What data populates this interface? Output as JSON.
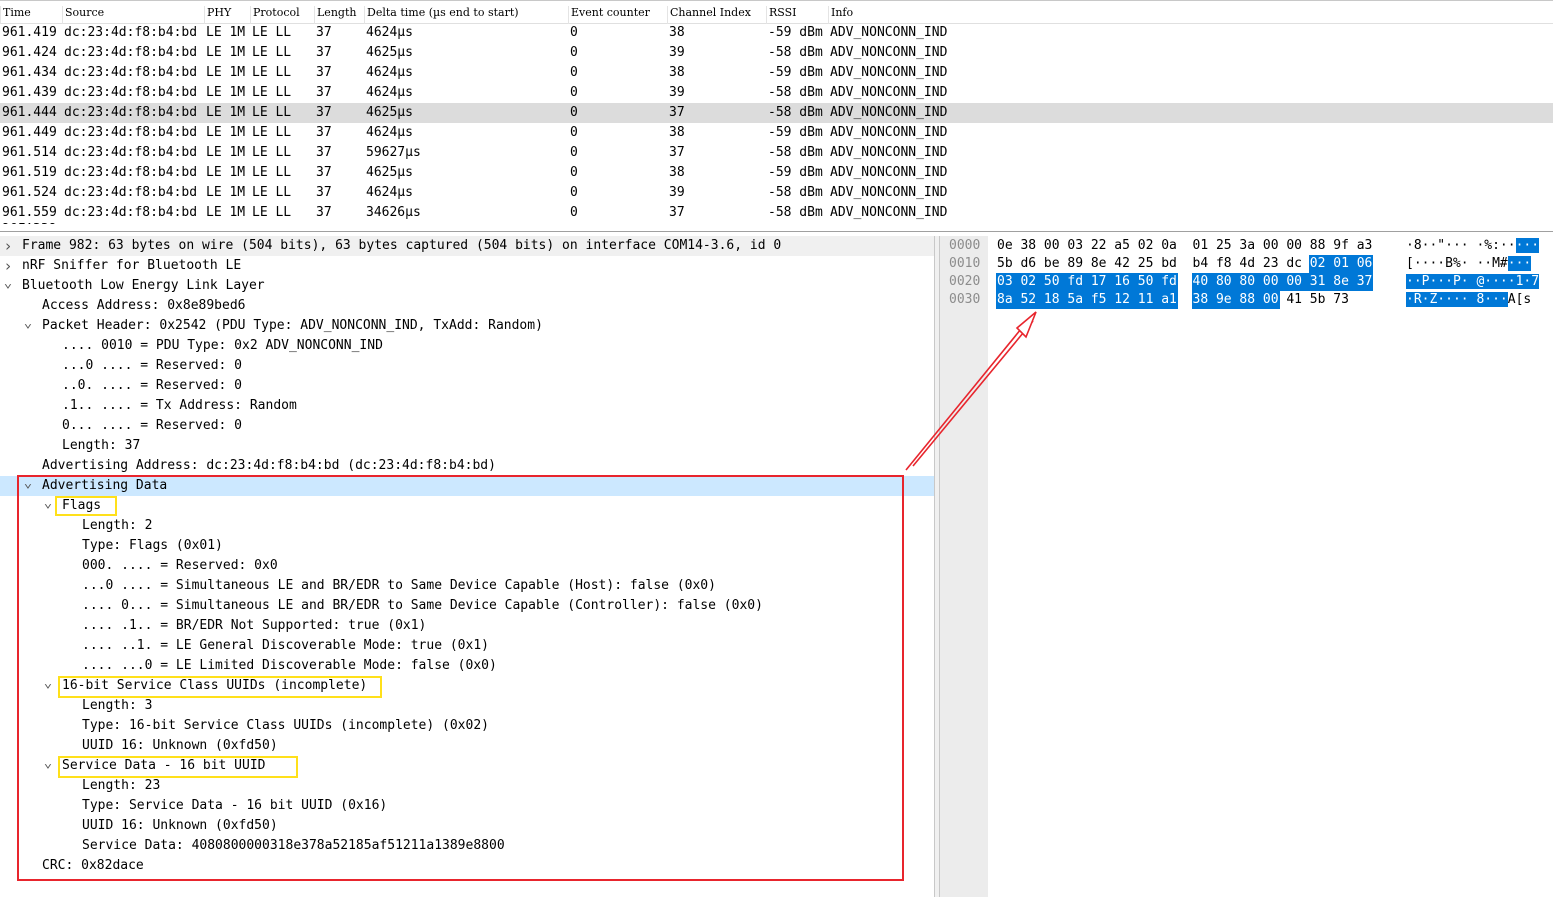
{
  "packet_list": {
    "columns": [
      "Time",
      "Source",
      "PHY",
      "Protocol",
      "Length",
      "Delta time (µs end to start)",
      "Event counter",
      "Channel Index",
      "RSSI",
      "Info"
    ],
    "rows": [
      {
        "time": "961.419",
        "source": "dc:23:4d:f8:b4:bd",
        "phy": "LE 1M",
        "protocol": "LE LL",
        "length": "37",
        "delta": "4624µs",
        "event": "0",
        "channel": "38",
        "rssi": "-59 dBm",
        "info": "ADV_NONCONN_IND"
      },
      {
        "time": "961.424",
        "source": "dc:23:4d:f8:b4:bd",
        "phy": "LE 1M",
        "protocol": "LE LL",
        "length": "37",
        "delta": "4625µs",
        "event": "0",
        "channel": "39",
        "rssi": "-58 dBm",
        "info": "ADV_NONCONN_IND"
      },
      {
        "time": "961.434",
        "source": "dc:23:4d:f8:b4:bd",
        "phy": "LE 1M",
        "protocol": "LE LL",
        "length": "37",
        "delta": "4624µs",
        "event": "0",
        "channel": "38",
        "rssi": "-59 dBm",
        "info": "ADV_NONCONN_IND"
      },
      {
        "time": "961.439",
        "source": "dc:23:4d:f8:b4:bd",
        "phy": "LE 1M",
        "protocol": "LE LL",
        "length": "37",
        "delta": "4624µs",
        "event": "0",
        "channel": "39",
        "rssi": "-58 dBm",
        "info": "ADV_NONCONN_IND"
      },
      {
        "time": "961.444",
        "source": "dc:23:4d:f8:b4:bd",
        "phy": "LE 1M",
        "protocol": "LE LL",
        "length": "37",
        "delta": "4625µs",
        "event": "0",
        "channel": "37",
        "rssi": "-58 dBm",
        "info": "ADV_NONCONN_IND"
      },
      {
        "time": "961.449",
        "source": "dc:23:4d:f8:b4:bd",
        "phy": "LE 1M",
        "protocol": "LE LL",
        "length": "37",
        "delta": "4624µs",
        "event": "0",
        "channel": "38",
        "rssi": "-59 dBm",
        "info": "ADV_NONCONN_IND"
      },
      {
        "time": "961.514",
        "source": "dc:23:4d:f8:b4:bd",
        "phy": "LE 1M",
        "protocol": "LE LL",
        "length": "37",
        "delta": "59627µs",
        "event": "0",
        "channel": "37",
        "rssi": "-58 dBm",
        "info": "ADV_NONCONN_IND"
      },
      {
        "time": "961.519",
        "source": "dc:23:4d:f8:b4:bd",
        "phy": "LE 1M",
        "protocol": "LE LL",
        "length": "37",
        "delta": "4625µs",
        "event": "0",
        "channel": "38",
        "rssi": "-59 dBm",
        "info": "ADV_NONCONN_IND"
      },
      {
        "time": "961.524",
        "source": "dc:23:4d:f8:b4:bd",
        "phy": "LE 1M",
        "protocol": "LE LL",
        "length": "37",
        "delta": "4624µs",
        "event": "0",
        "channel": "39",
        "rssi": "-58 dBm",
        "info": "ADV_NONCONN_IND"
      },
      {
        "time": "961.559",
        "source": "dc:23:4d:f8:b4:bd",
        "phy": "LE 1M",
        "protocol": "LE LL",
        "length": "37",
        "delta": "34626µs",
        "event": "0",
        "channel": "37",
        "rssi": "-58 dBm",
        "info": "ADV_NONCONN_IND"
      }
    ]
  },
  "details": {
    "lines": [
      {
        "text": "Frame 982: 63 bytes on wire (504 bits), 63 bytes captured (504 bits) on interface COM14-3.6, id 0",
        "level": 0,
        "toggle": "collapsed"
      },
      {
        "text": "nRF Sniffer for Bluetooth LE",
        "level": 0,
        "toggle": "collapsed"
      },
      {
        "text": "Bluetooth Low Energy Link Layer",
        "level": 0,
        "toggle": "expanded"
      },
      {
        "text": "Access Address: 0x8e89bed6",
        "level": 1,
        "toggle": "none"
      },
      {
        "text": "Packet Header: 0x2542 (PDU Type: ADV_NONCONN_IND, TxAdd: Random)",
        "level": 1,
        "toggle": "expanded"
      },
      {
        "text": ".... 0010 = PDU Type: 0x2 ADV_NONCONN_IND",
        "level": 2,
        "toggle": "none"
      },
      {
        "text": "...0 .... = Reserved: 0",
        "level": 2,
        "toggle": "none"
      },
      {
        "text": "..0. .... = Reserved: 0",
        "level": 2,
        "toggle": "none"
      },
      {
        "text": ".1.. .... = Tx Address: Random",
        "level": 2,
        "toggle": "none"
      },
      {
        "text": "0... .... = Reserved: 0",
        "level": 2,
        "toggle": "none"
      },
      {
        "text": "Length: 37",
        "level": 2,
        "toggle": "none"
      },
      {
        "text": "Advertising Address: dc:23:4d:f8:b4:bd (dc:23:4d:f8:b4:bd)",
        "level": 1,
        "toggle": "none"
      },
      {
        "text": "Advertising Data",
        "level": 1,
        "toggle": "expanded",
        "selected": true
      },
      {
        "text": "Flags",
        "level": 2,
        "toggle": "expanded"
      },
      {
        "text": "Length: 2",
        "level": 3,
        "toggle": "none"
      },
      {
        "text": "Type: Flags (0x01)",
        "level": 3,
        "toggle": "none"
      },
      {
        "text": "000. .... = Reserved: 0x0",
        "level": 3,
        "toggle": "none"
      },
      {
        "text": "...0 .... = Simultaneous LE and BR/EDR to Same Device Capable (Host): false (0x0)",
        "level": 3,
        "toggle": "none"
      },
      {
        "text": ".... 0... = Simultaneous LE and BR/EDR to Same Device Capable (Controller): false (0x0)",
        "level": 3,
        "toggle": "none"
      },
      {
        "text": ".... .1.. = BR/EDR Not Supported: true (0x1)",
        "level": 3,
        "toggle": "none"
      },
      {
        "text": ".... ..1. = LE General Discoverable Mode: true (0x1)",
        "level": 3,
        "toggle": "none"
      },
      {
        "text": ".... ...0 = LE Limited Discoverable Mode: false (0x0)",
        "level": 3,
        "toggle": "none"
      },
      {
        "text": "16-bit Service Class UUIDs (incomplete)",
        "level": 2,
        "toggle": "expanded"
      },
      {
        "text": "Length: 3",
        "level": 3,
        "toggle": "none"
      },
      {
        "text": "Type: 16-bit Service Class UUIDs (incomplete) (0x02)",
        "level": 3,
        "toggle": "none"
      },
      {
        "text": "UUID 16: Unknown (0xfd50)",
        "level": 3,
        "toggle": "none"
      },
      {
        "text": "Service Data - 16 bit UUID",
        "level": 2,
        "toggle": "expanded"
      },
      {
        "text": "Length: 23",
        "level": 3,
        "toggle": "none"
      },
      {
        "text": "Type: Service Data - 16 bit UUID (0x16)",
        "level": 3,
        "toggle": "none"
      },
      {
        "text": "UUID 16: Unknown (0xfd50)",
        "level": 3,
        "toggle": "none"
      },
      {
        "text": "Service Data: 4080800000318e378a52185af51211a1389e8800",
        "level": 3,
        "toggle": "none"
      },
      {
        "text": "CRC: 0x82dace",
        "level": 1,
        "toggle": "none"
      }
    ]
  },
  "bytes": {
    "rows": [
      {
        "offset": "0000",
        "hex": [
          "0e",
          "38",
          "00",
          "03",
          "22",
          "a5",
          "02",
          "0a",
          "01",
          "25",
          "3a",
          "00",
          "00",
          "88",
          "9f",
          "a3"
        ],
        "ascii": "·8··\"···  ·%:·····",
        "hl_from": 99,
        "ascii_text": "·8··\"··· ·%:·····"
      },
      {
        "offset": "0010",
        "hex": [
          "5b",
          "d6",
          "be",
          "89",
          "8e",
          "42",
          "25",
          "bd",
          "b4",
          "f8",
          "4d",
          "23",
          "dc",
          "02",
          "01",
          "06"
        ],
        "ascii_text": "[····B%· ··M#···",
        "hl_from": 13
      },
      {
        "offset": "0020",
        "hex": [
          "03",
          "02",
          "50",
          "fd",
          "17",
          "16",
          "50",
          "fd",
          "40",
          "80",
          "80",
          "00",
          "00",
          "31",
          "8e",
          "37"
        ],
        "ascii_text": "··P···P· @····1·7",
        "hl_from": 0
      },
      {
        "offset": "0030",
        "hex": [
          "8a",
          "52",
          "18",
          "5a",
          "f5",
          "12",
          "11",
          "a1",
          "38",
          "9e",
          "88",
          "00",
          "41",
          "5b",
          "73"
        ],
        "ascii_text": "·R·Z···· 8···A[s",
        "hl_from": 0,
        "hl_to": 11
      }
    ]
  },
  "colors": {
    "selection": "#0078d7",
    "tree_selection": "#cce8ff",
    "annotation_red": "#e8252d",
    "annotation_yellow": "#ffe01a"
  }
}
